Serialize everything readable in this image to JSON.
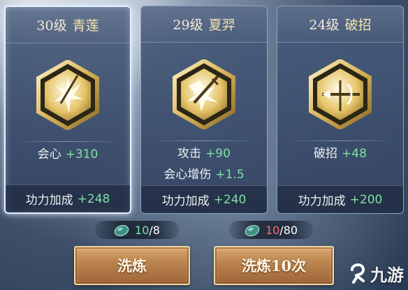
{
  "cards": [
    {
      "level": "30级",
      "name": "青莲",
      "emblem_icon": "burst-sword-icon",
      "selected": true,
      "stats": [
        {
          "label": "会心",
          "value": "+310"
        }
      ],
      "bonus": {
        "label": "功力加成",
        "value": "+248"
      }
    },
    {
      "level": "29级",
      "name": "夏羿",
      "emblem_icon": "sword-strike-icon",
      "selected": false,
      "stats": [
        {
          "label": "攻击",
          "value": "+90"
        },
        {
          "label": "会心增伤",
          "value": "+1.5"
        }
      ],
      "bonus": {
        "label": "功力加成",
        "value": "+240"
      }
    },
    {
      "level": "24级",
      "name": "破招",
      "emblem_icon": "cross-blade-icon",
      "selected": false,
      "stats": [
        {
          "label": "破招",
          "value": "+48"
        }
      ],
      "bonus": {
        "label": "功力加成",
        "value": "+200"
      }
    }
  ],
  "costs": [
    {
      "have": "10",
      "need": "/8",
      "icon": "jade-stone-icon",
      "sufficient": true
    },
    {
      "have": "10",
      "need": "/80",
      "icon": "jade-stone-icon",
      "sufficient": false
    }
  ],
  "buttons": {
    "refine_once": "洗炼",
    "refine_ten": "洗炼10次"
  },
  "watermark": "九游",
  "colors": {
    "value_green": "#7fe0a4",
    "insufficient_red": "#ff6a6a",
    "name_gold": "#f4e2b0"
  }
}
